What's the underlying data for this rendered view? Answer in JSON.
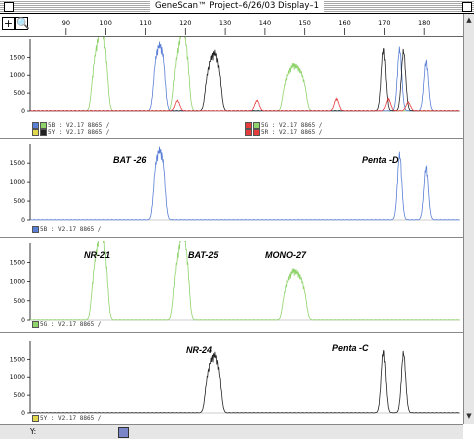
{
  "window": {
    "title": "GeneScan™ Project–6/26/03 Display–1"
  },
  "toolbar": {
    "zoom_icon": "zoom-in-icon",
    "plus_icon": "plus-icon"
  },
  "x_axis": {
    "ticks": [
      "90",
      "100",
      "110",
      "120",
      "130",
      "140",
      "150",
      "160",
      "170",
      "180"
    ],
    "tick_values": [
      90,
      100,
      110,
      120,
      130,
      140,
      150,
      160,
      170,
      180
    ],
    "range": [
      81,
      189
    ]
  },
  "panels": [
    {
      "id": "combined",
      "y_ticks": [
        "1500",
        "1000",
        "500",
        "0"
      ],
      "y_tick_values": [
        1500,
        1000,
        500,
        0
      ],
      "ymax": 1900,
      "legend": [
        {
          "swatches": [
            "#5a7fd6",
            "#8fd36b"
          ],
          "text": "5B : V2.17 8865 /"
        },
        {
          "swatches": [
            "#e0d84a",
            "#222222"
          ],
          "text": "5Y : V2.17 8865 /"
        },
        {
          "swatches": [
            "#e63c3c",
            "#8fd36b"
          ],
          "text": "5G : V2.17 8865 /"
        },
        {
          "swatches": [
            "#e63c3c",
            "#e63c3c"
          ],
          "text": "5R : V2.17 8865 /"
        }
      ],
      "annotations": []
    },
    {
      "id": "blue",
      "y_ticks": [
        "1500",
        "1000",
        "500",
        "0"
      ],
      "y_tick_values": [
        1500,
        1000,
        500,
        0
      ],
      "ymax": 1900,
      "legend": [
        {
          "swatches": [
            "#5a7fd6"
          ],
          "text": "5B : V2.17 8865 /"
        }
      ],
      "annotations": [
        "BAT -26",
        "Penta -D"
      ]
    },
    {
      "id": "green",
      "y_ticks": [
        "1500",
        "1000",
        "500",
        "0"
      ],
      "y_tick_values": [
        1500,
        1000,
        500,
        0
      ],
      "ymax": 1900,
      "legend": [
        {
          "swatches": [
            "#8fd36b"
          ],
          "text": "5G : V2.17 8865 /"
        }
      ],
      "annotations": [
        "NR-21",
        "BAT-25",
        "MONO-27"
      ]
    },
    {
      "id": "yellow",
      "y_ticks": [
        "1500",
        "1000",
        "500",
        "0"
      ],
      "y_tick_values": [
        1500,
        1000,
        500,
        0
      ],
      "ymax": 1900,
      "legend": [
        {
          "swatches": [
            "#e0d84a"
          ],
          "text": "5Y : V2.17 8865 /"
        }
      ],
      "annotations": [
        "NR-24",
        "Penta -C"
      ]
    }
  ],
  "traces": {
    "blue": {
      "color": "#5a7fd6",
      "peaks": [
        [
          112.5,
          1200
        ],
        [
          113.5,
          1450
        ],
        [
          114.5,
          1300
        ],
        [
          173.8,
          1800
        ],
        [
          180.5,
          1450
        ]
      ]
    },
    "green": {
      "color": "#8fd36b",
      "peaks": [
        [
          97,
          1000
        ],
        [
          98,
          1500
        ],
        [
          99,
          1900
        ],
        [
          100,
          1300
        ],
        [
          117.5,
          1000
        ],
        [
          118.5,
          1500
        ],
        [
          119.5,
          1850
        ],
        [
          120.5,
          1300
        ],
        [
          145,
          600
        ],
        [
          146,
          850
        ],
        [
          147,
          1000
        ],
        [
          148,
          950
        ],
        [
          149,
          850
        ],
        [
          150,
          600
        ]
      ]
    },
    "yellow": {
      "color": "#222222",
      "peaks": [
        [
          125.5,
          800
        ],
        [
          126.5,
          1150
        ],
        [
          127.5,
          1300
        ],
        [
          128.5,
          950
        ],
        [
          169.8,
          1800
        ],
        [
          174.8,
          1750
        ]
      ]
    },
    "red": {
      "color": "#e63c3c",
      "peaks": [
        [
          118,
          300
        ],
        [
          138,
          300
        ],
        [
          158,
          350
        ],
        [
          171,
          350
        ],
        [
          176,
          250
        ]
      ]
    }
  },
  "hscroll": {
    "label": "Y:"
  }
}
